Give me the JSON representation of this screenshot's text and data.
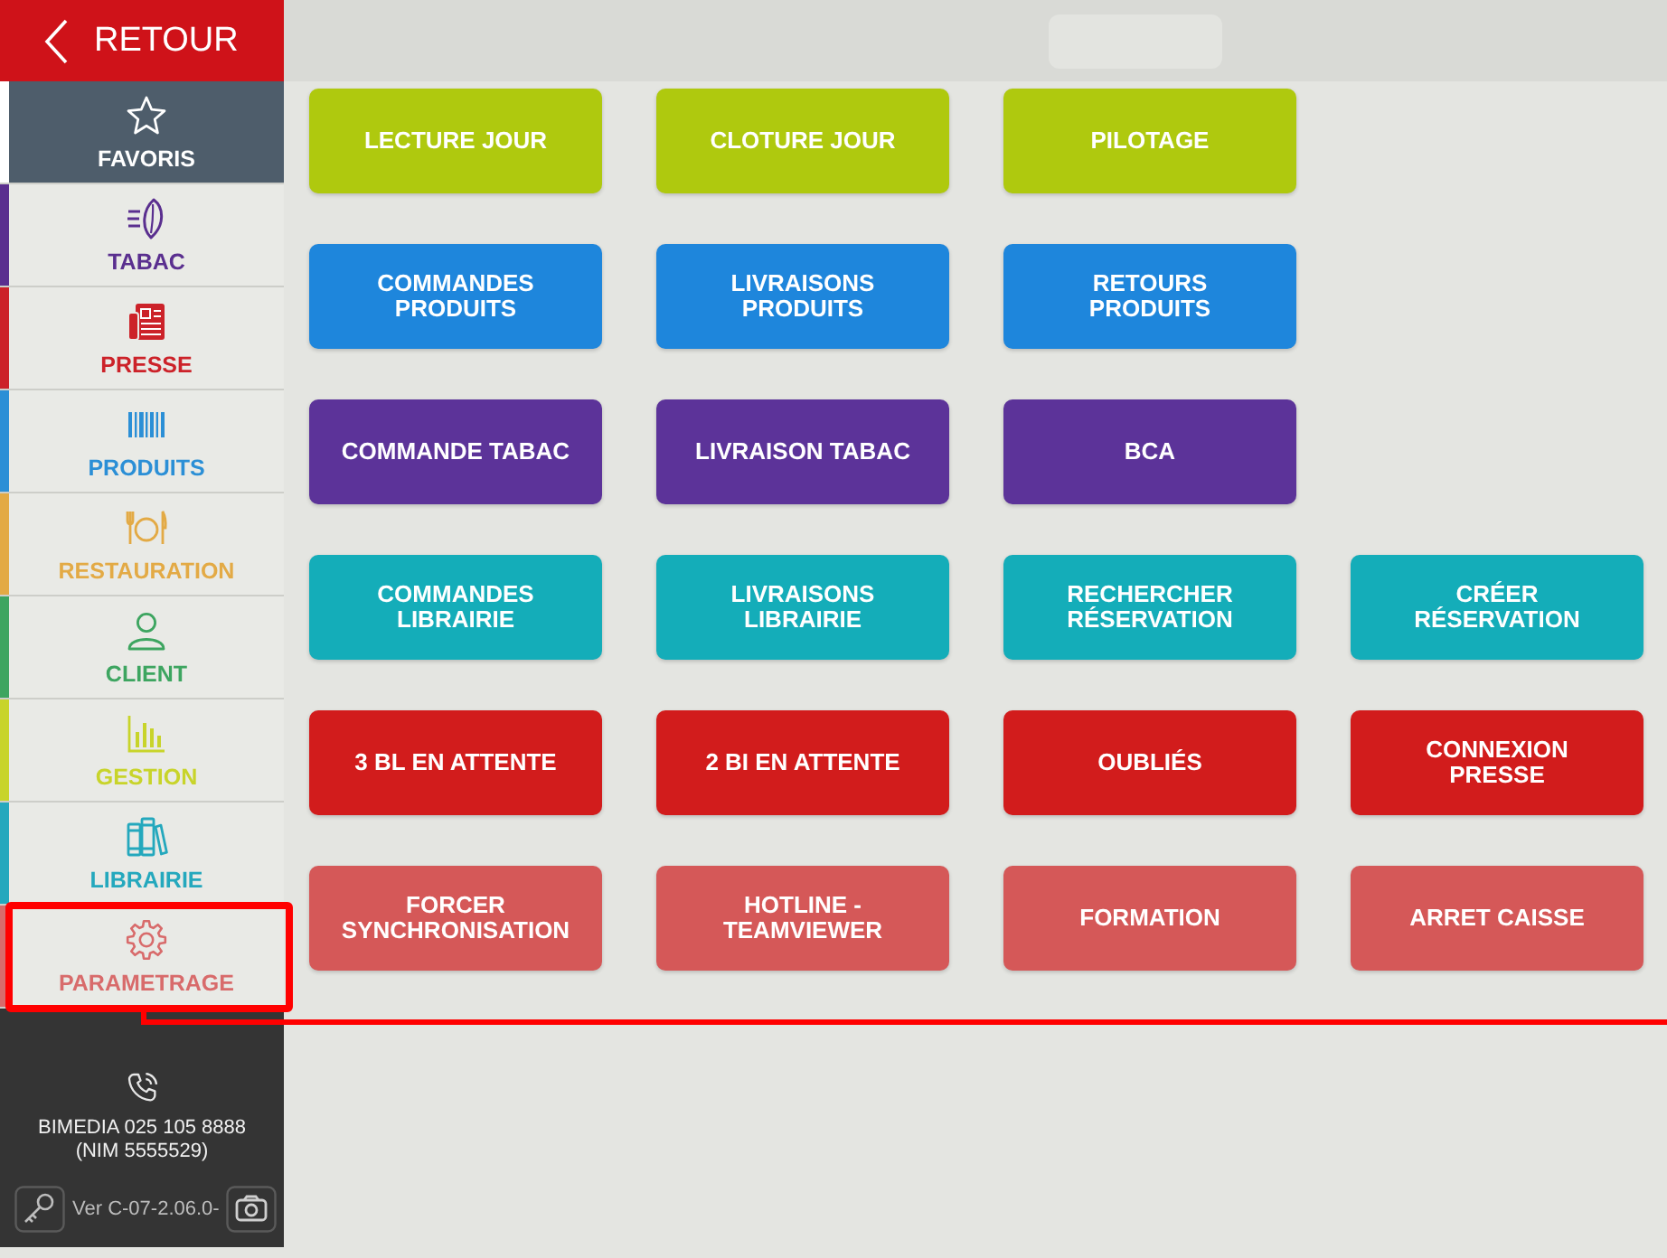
{
  "sidebar": {
    "back_button": {
      "label": "RETOUR"
    },
    "items": [
      {
        "label": "FAVORIS",
        "color": "#ffffff",
        "selected": true,
        "highlighted": false
      },
      {
        "label": "TABAC",
        "color": "#5a2f8f",
        "selected": false,
        "highlighted": false
      },
      {
        "label": "PRESSE",
        "color": "#cc2229",
        "selected": false,
        "highlighted": false
      },
      {
        "label": "PRODUITS",
        "color": "#2b8fd6",
        "selected": false,
        "highlighted": false
      },
      {
        "label": "RESTAURATION",
        "color": "#e3aa45",
        "selected": false,
        "highlighted": false
      },
      {
        "label": "CLIENT",
        "color": "#3da560",
        "selected": false,
        "highlighted": false
      },
      {
        "label": "GESTION",
        "color": "#c8d42a",
        "selected": false,
        "highlighted": false
      },
      {
        "label": "LIBRAIRIE",
        "color": "#24a8bd",
        "selected": false,
        "highlighted": false
      },
      {
        "label": "PARAMETRAGE",
        "color": "#d86b6b",
        "selected": false,
        "highlighted": true
      }
    ],
    "footer": {
      "contact": "BIMEDIA 025 105 8888",
      "nim": "(NIM 5555529)",
      "version": "Ver C-07-2.06.0-"
    }
  },
  "menu": {
    "rows": [
      {
        "buttons": [
          {
            "label": "LECTURE JOUR",
            "color": "#afc90e"
          },
          {
            "label": "CLOTURE JOUR",
            "color": "#afc90e"
          },
          {
            "label": "PILOTAGE",
            "color": "#afc90e"
          }
        ]
      },
      {
        "buttons": [
          {
            "label": "COMMANDES\nPRODUITS",
            "color": "#1e86dc"
          },
          {
            "label": "LIVRAISONS\nPRODUITS",
            "color": "#1e86dc"
          },
          {
            "label": "RETOURS\nPRODUITS",
            "color": "#1e86dc"
          }
        ]
      },
      {
        "buttons": [
          {
            "label": "COMMANDE TABAC",
            "color": "#5c3399"
          },
          {
            "label": "LIVRAISON TABAC",
            "color": "#5c3399"
          },
          {
            "label": "BCA",
            "color": "#5c3399"
          }
        ]
      },
      {
        "buttons": [
          {
            "label": "COMMANDES\nLIBRAIRIE",
            "color": "#14adb9"
          },
          {
            "label": "LIVRAISONS\nLIBRAIRIE",
            "color": "#14adb9"
          },
          {
            "label": "RECHERCHER\nRÉSERVATION",
            "color": "#14adb9"
          },
          {
            "label": "CRÉER\nRÉSERVATION",
            "color": "#14adb9"
          }
        ]
      },
      {
        "buttons": [
          {
            "label": "3 BL EN ATTENTE",
            "color": "#d21c1c"
          },
          {
            "label": "2 BI EN ATTENTE",
            "color": "#d21c1c"
          },
          {
            "label": "OUBLIÉS",
            "color": "#d21c1c"
          },
          {
            "label": "CONNEXION\nPRESSE",
            "color": "#d21c1c"
          }
        ]
      },
      {
        "buttons": [
          {
            "label": "FORCER\nSYNCHRONISATION",
            "color": "#d55858"
          },
          {
            "label": "HOTLINE -\nTEAMVIEWER",
            "color": "#d55858"
          },
          {
            "label": "FORMATION",
            "color": "#d55858"
          },
          {
            "label": "ARRET CAISSE",
            "color": "#d55858"
          }
        ]
      }
    ]
  }
}
